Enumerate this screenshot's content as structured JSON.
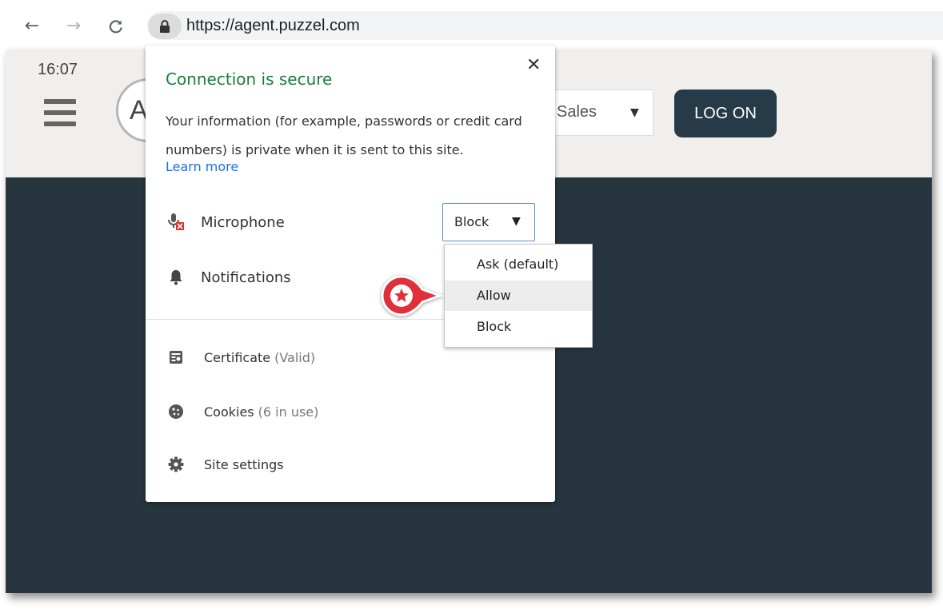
{
  "browser": {
    "url": "https://agent.puzzel.com",
    "back_icon": "arrow-left-icon",
    "forward_icon": "arrow-right-icon",
    "reload_icon": "reload-icon",
    "lock_icon": "lock-icon"
  },
  "page": {
    "time": "16:07",
    "logo_letter": "A",
    "queue_value": "Sales",
    "logon_label": "LOG ON",
    "body_color": "#26353e",
    "button_color": "#263a47"
  },
  "popup": {
    "title": "Connection is secure",
    "description": "Your information (for example, passwords or credit card numbers) is private when it is sent to this site.",
    "learn_more": "Learn more",
    "permissions": [
      {
        "label": "Microphone",
        "icon": "microphone-blocked-icon",
        "value": "Block"
      },
      {
        "label": "Notifications",
        "icon": "bell-icon"
      }
    ],
    "info_items": [
      {
        "label": "Certificate",
        "detail": "(Valid)",
        "icon": "certificate-icon"
      },
      {
        "label": "Cookies",
        "detail": "(6 in use)",
        "icon": "cookie-icon"
      },
      {
        "label": "Site settings",
        "detail": "",
        "icon": "gear-icon"
      }
    ]
  },
  "dropdown": {
    "options": [
      "Ask (default)",
      "Allow",
      "Block"
    ],
    "highlighted": "Allow"
  },
  "colors": {
    "secure_green": "#188038",
    "link_blue": "#1a73e8",
    "marker_red": "#e0303a"
  }
}
